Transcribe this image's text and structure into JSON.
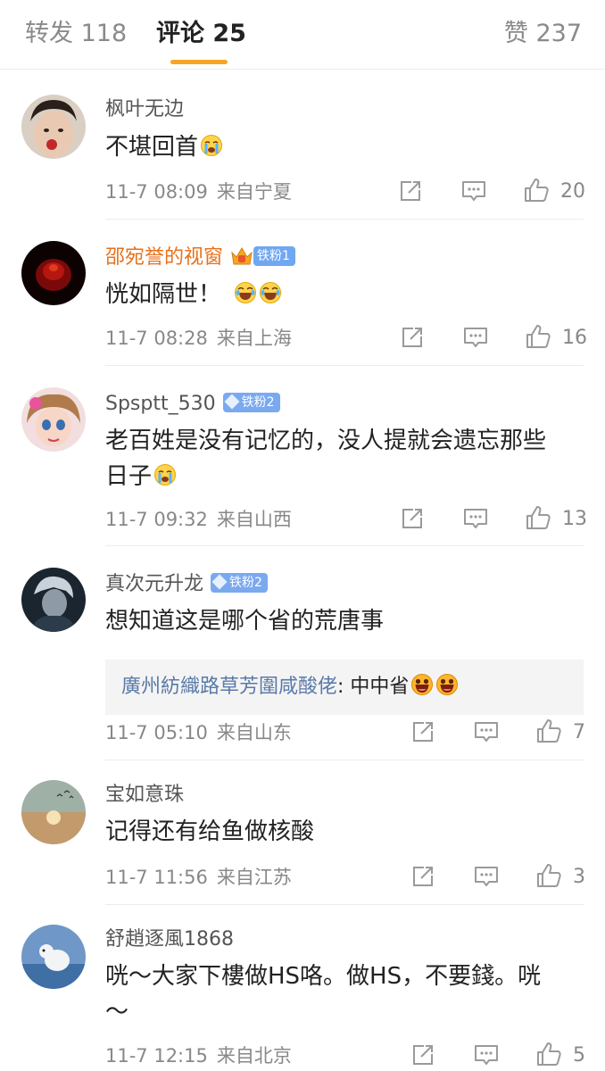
{
  "tabs": [
    {
      "label": "转发 118"
    },
    {
      "label": "评论 25"
    },
    {
      "label": "赞 237"
    }
  ],
  "colors": {
    "accent": "#f5a623",
    "reply_name": "#5a7aa8",
    "vip_name": "#e8701a"
  },
  "comments": [
    {
      "name": "枫叶无边",
      "text": "不堪回首",
      "time": "11-7 08:09",
      "location": "来自宁夏",
      "likes": "20"
    },
    {
      "name": "邵宛誉的视窗",
      "badge": "铁粉1",
      "text": "恍如隔世！",
      "time": "11-7 08:28",
      "location": "来自上海",
      "likes": "16"
    },
    {
      "name": "Spsptt_530",
      "badge": "铁粉2",
      "text_line1": "老百姓是没有记忆的，没人提就会遗忘那些",
      "text_line2": "日子",
      "time": "11-7 09:32",
      "location": "来自山西",
      "likes": "13"
    },
    {
      "name": "真次元升龙",
      "badge": "铁粉2",
      "text": "想知道这是哪个省的荒唐事",
      "reply_name": "廣州紡織路草芳圍咸酸佬",
      "reply_text": ": 中中省",
      "time": "11-7 05:10",
      "location": "来自山东",
      "likes": "7"
    },
    {
      "name": "宝如意珠",
      "text": "记得还有给鱼做核酸",
      "time": "11-7 11:56",
      "location": "来自江苏",
      "likes": "3"
    },
    {
      "name": "舒趙逐風1868",
      "text_line1": "咣～大家下樓做HS咯。做HS，不要錢。咣",
      "text_line2": "～",
      "time": "11-7 12:15",
      "location": "来自北京",
      "likes": "5"
    }
  ]
}
